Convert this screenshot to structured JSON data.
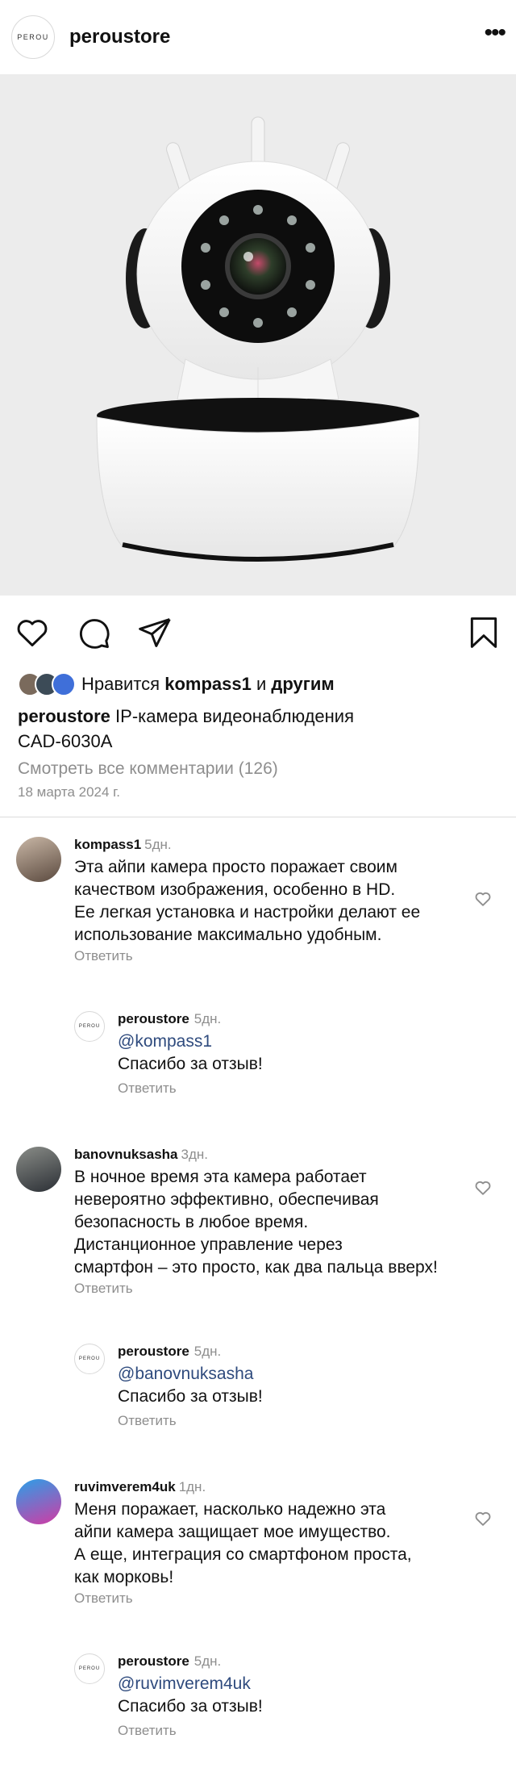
{
  "header": {
    "logo_text": "PEROU",
    "username": "peroustore",
    "more_icon": "more-horizontal-icon"
  },
  "post": {
    "image_alt": "IP-камера видеонаблюдения CAD-6030A",
    "likes": {
      "prefix": "Нравится",
      "user": "kompass1",
      "joiner": "и",
      "suffix": "другим"
    },
    "caption_user": "peroustore",
    "caption_line1": "IP-камера видеонаблюдения",
    "caption_line2": "CAD-6030A",
    "view_all_comments": "Смотреть все комментарии (126)",
    "date": "18 марта 2024 г."
  },
  "comments": [
    {
      "user": "kompass1",
      "time": "5дн.",
      "lines": [
        "Эта айпи камера просто поражает своим",
        "качеством изображения, особенно в HD.",
        "Ее легкая установка и настройки делают ее",
        "использование максимально удобным."
      ],
      "reply_label": "Ответить",
      "response": {
        "user": "peroustore",
        "time": "5дн.",
        "mention": "@kompass1",
        "text": "Спасибо за отзыв!",
        "reply_label": "Ответить"
      }
    },
    {
      "user": "banovnuksasha",
      "time": "3дн.",
      "lines": [
        "В ночное время эта камера работает",
        "невероятно эффективно, обеспечивая",
        "безопасность в любое время.",
        "Дистанционное управление через",
        "смартфон – это просто, как два пальца вверх!"
      ],
      "reply_label": "Ответить",
      "response": {
        "user": "peroustore",
        "time": "5дн.",
        "mention": "@banovnuksasha",
        "text": "Спасибо за отзыв!",
        "reply_label": "Ответить"
      }
    },
    {
      "user": "ruvimverem4uk",
      "time": "1дн.",
      "lines": [
        "Меня поражает, насколько надежно эта",
        "айпи камера защищает мое имущество.",
        "А еще, интеграция со смартфоном проста,",
        "как морковь!"
      ],
      "reply_label": "Ответить",
      "response": {
        "user": "peroustore",
        "time": "5дн.",
        "mention": "@ruvimverem4uk",
        "text": "Спасибо за отзыв!",
        "reply_label": "Ответить"
      }
    }
  ],
  "colors": {
    "mention": "#2e4a7d",
    "muted": "#8e8e8e",
    "divider": "#dbdbdb",
    "photo_bg": "#ececec"
  }
}
